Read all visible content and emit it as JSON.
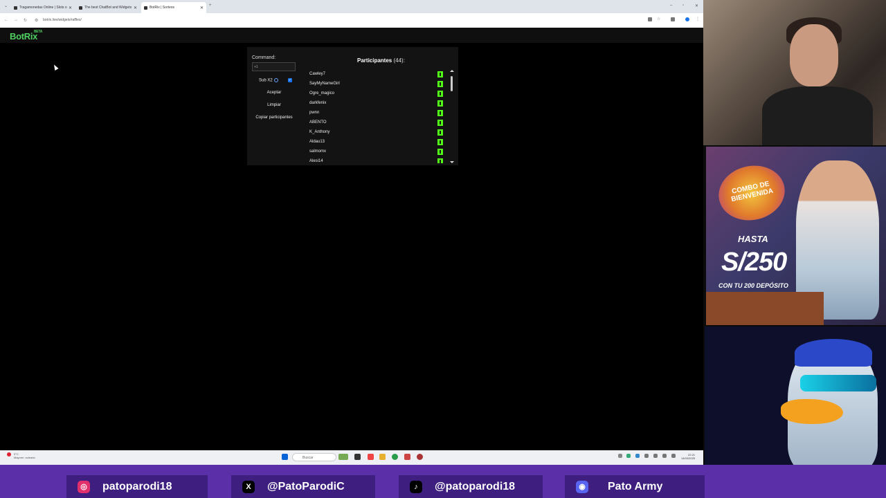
{
  "browser": {
    "tabs": [
      {
        "title": "Tragamonedas Online | Slots o"
      },
      {
        "title": "The best ChatBot and Widgets"
      },
      {
        "title": "BotRix | Sorteos"
      }
    ],
    "url": "botrix.live/widgets/raffles/"
  },
  "site": {
    "logo": "BotRix",
    "beta": "BETA"
  },
  "raffle": {
    "command_label": "Command:",
    "command_value": "+1",
    "sub_label": "Sub X2",
    "sub_checked": true,
    "accept_label": "Aceptar",
    "clear_label": "Limpiar",
    "copy_label": "Copiar participantes",
    "participants_label": "Participantes",
    "participants_count": "(44):",
    "participants": [
      "Cawley7",
      "SayMyNameGirl",
      "Ogre_magico",
      "darkfenix",
      "pwnn",
      "ABENTO",
      "K_Anthony",
      "Aldau13",
      "salmomx",
      "Alesi14"
    ]
  },
  "taskbar": {
    "search_placeholder": "Buscar",
    "weather_temp": "9°C",
    "weather_text": "Mayorm. soleado",
    "time": "22:21",
    "date": "14/03/2025"
  },
  "ad": {
    "combo_line1": "COMBO DE",
    "combo_line2": "BIENVENIDA",
    "hasta": "HASTA",
    "amount": "S/250",
    "subtitle": "CON TU 200 DEPÓSITO"
  },
  "social": [
    {
      "icon": "instagram-icon",
      "handle": "patoparodi18",
      "color": "#e1306c"
    },
    {
      "icon": "x-icon",
      "handle": "@PatoParodiC",
      "color": "#000000"
    },
    {
      "icon": "tiktok-icon",
      "handle": "@patoparodi18",
      "color": "#000000"
    },
    {
      "icon": "discord-icon",
      "handle": "Pato Army",
      "color": "#5865f2"
    }
  ]
}
